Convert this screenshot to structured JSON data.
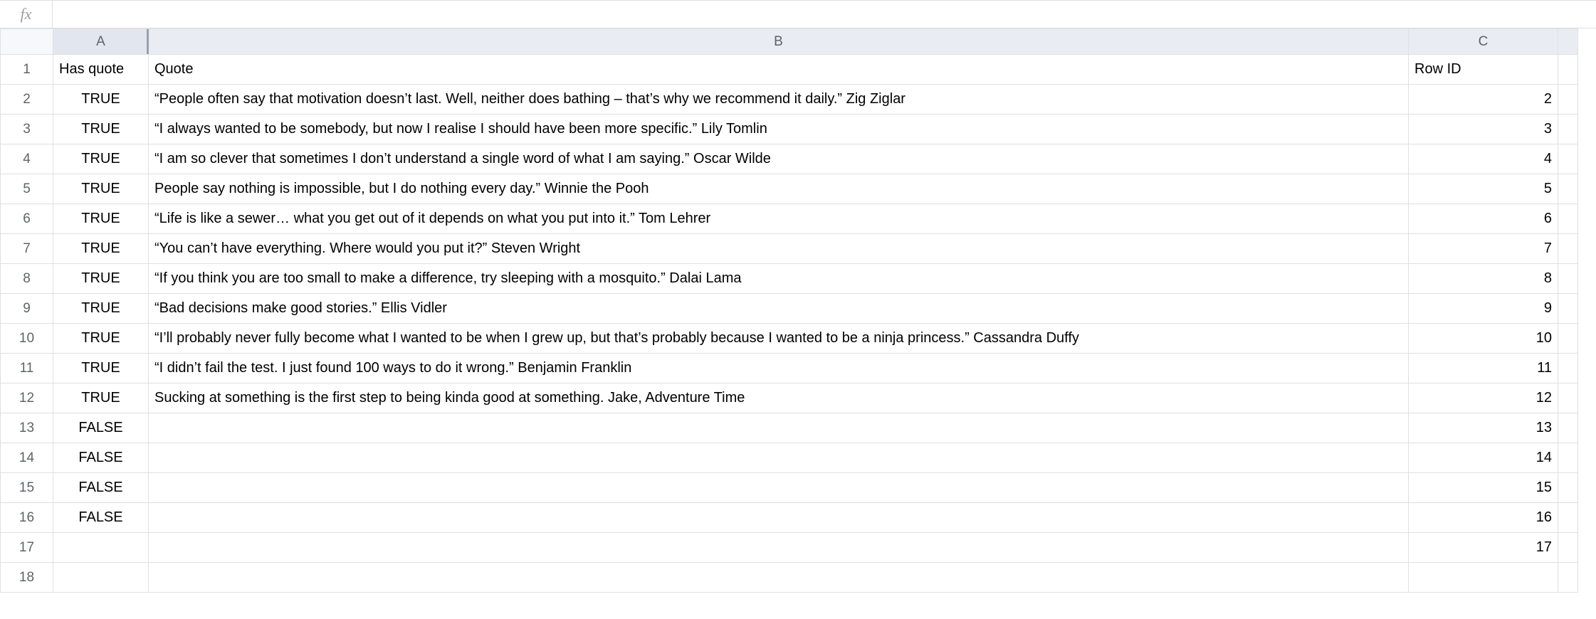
{
  "formula_bar": {
    "fx_label": "fx",
    "value": ""
  },
  "columns": {
    "corner": "",
    "A": "A",
    "B": "B",
    "C": "C",
    "D": ""
  },
  "header_row": {
    "A": "Has quote",
    "B": "Quote",
    "C": "Row ID"
  },
  "rows": [
    {
      "n": 1,
      "A": "Has quote",
      "B": "Quote",
      "C": "Row ID",
      "header": true
    },
    {
      "n": 2,
      "A": "TRUE",
      "B": " “People often say that motivation doesn’t last. Well, neither does bathing – that’s why we recommend it daily.” Zig Ziglar",
      "C": "2"
    },
    {
      "n": 3,
      "A": "TRUE",
      "B": "“I always wanted to be somebody, but now I realise I should have been more specific.” Lily Tomlin",
      "C": "3"
    },
    {
      "n": 4,
      "A": "TRUE",
      "B": "“I am so clever that sometimes I don’t understand a single word of what I am saying.” Oscar Wilde",
      "C": "4"
    },
    {
      "n": 5,
      "A": "TRUE",
      "B": "People say nothing is impossible, but I do nothing every day.” Winnie the Pooh",
      "C": "5"
    },
    {
      "n": 6,
      "A": "TRUE",
      "B": "“Life is like a sewer… what you get out of it depends on what you put into it.” Tom Lehrer",
      "C": "6"
    },
    {
      "n": 7,
      "A": "TRUE",
      "B": "“You can’t have everything. Where would you put it?” Steven Wright",
      "C": "7"
    },
    {
      "n": 8,
      "A": "TRUE",
      "B": "“If you think you are too small to make a difference, try sleeping with a mosquito.” Dalai Lama",
      "C": "8"
    },
    {
      "n": 9,
      "A": "TRUE",
      "B": "“Bad decisions make good stories.” Ellis Vidler",
      "C": "9"
    },
    {
      "n": 10,
      "A": "TRUE",
      "B": "“I’ll probably never fully become what I wanted to be when I grew up, but that’s probably because I wanted to be a ninja princess.” Cassandra Duffy",
      "C": "10"
    },
    {
      "n": 11,
      "A": "TRUE",
      "B": "“I didn’t fail the test. I just found 100 ways to do it wrong.” Benjamin Franklin",
      "C": "11"
    },
    {
      "n": 12,
      "A": "TRUE",
      "B": "Sucking at something is the first step to being kinda good at something. Jake, Adventure Time",
      "C": "12"
    },
    {
      "n": 13,
      "A": "FALSE",
      "B": "",
      "C": "13"
    },
    {
      "n": 14,
      "A": "FALSE",
      "B": "",
      "C": "14"
    },
    {
      "n": 15,
      "A": "FALSE",
      "B": "",
      "C": "15"
    },
    {
      "n": 16,
      "A": "FALSE",
      "B": "",
      "C": "16"
    },
    {
      "n": 17,
      "A": "",
      "B": "",
      "C": "17"
    },
    {
      "n": 18,
      "A": "",
      "B": "",
      "C": ""
    }
  ]
}
